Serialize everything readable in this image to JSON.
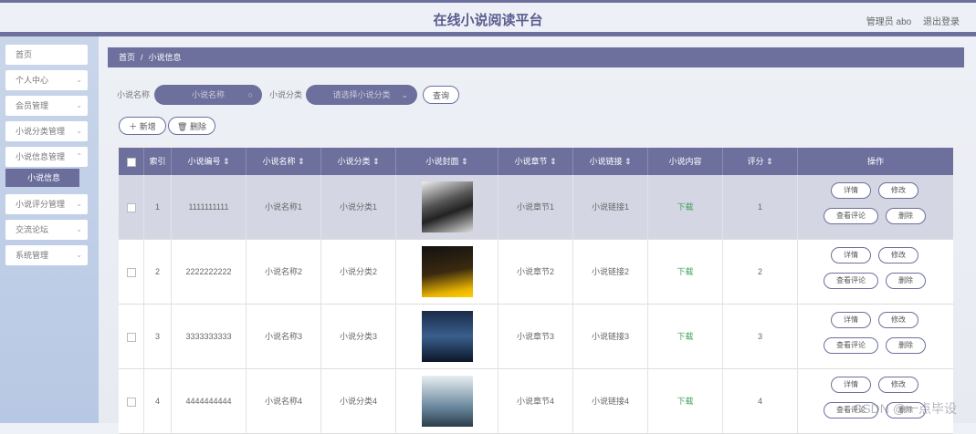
{
  "header": {
    "title": "在线小说阅读平台",
    "user_label": "管理员 abo",
    "logout": "退出登录"
  },
  "sidebar": {
    "items": [
      {
        "label": "首页",
        "chevron": false
      },
      {
        "label": "个人中心",
        "chevron": true
      },
      {
        "label": "会员管理",
        "chevron": true
      },
      {
        "label": "小说分类管理",
        "chevron": true
      },
      {
        "label": "小说信息管理",
        "chevron": true
      },
      {
        "label": "小说评分管理",
        "chevron": true
      },
      {
        "label": "交流论坛",
        "chevron": true
      },
      {
        "label": "系统管理",
        "chevron": true
      }
    ],
    "active_sub": "小说信息"
  },
  "breadcrumb": {
    "home": "首页",
    "sep": "/",
    "current": "小说信息"
  },
  "search": {
    "name_label": "小说名称",
    "name_placeholder": "小说名称",
    "category_label": "小说分类",
    "category_placeholder": "请选择小说分类",
    "query_button": "查询"
  },
  "actions": {
    "add": "＋ 新增",
    "delete": "🗑 删除"
  },
  "table": {
    "headers": [
      "索引",
      "小说编号 ⇕",
      "小说名称 ⇕",
      "小说分类 ⇕",
      "小说封面 ⇕",
      "小说章节 ⇕",
      "小说链接 ⇕",
      "小说内容",
      "评分 ⇕",
      "操作"
    ],
    "rows": [
      {
        "index": "1",
        "code": "1111111111",
        "name": "小说名称1",
        "category": "小说分类1",
        "chapter": "小说章节1",
        "link": "小说链接1",
        "content": "下载",
        "score": "1"
      },
      {
        "index": "2",
        "code": "2222222222",
        "name": "小说名称2",
        "category": "小说分类2",
        "chapter": "小说章节2",
        "link": "小说链接2",
        "content": "下载",
        "score": "2"
      },
      {
        "index": "3",
        "code": "3333333333",
        "name": "小说名称3",
        "category": "小说分类3",
        "chapter": "小说章节3",
        "link": "小说链接3",
        "content": "下载",
        "score": "3"
      },
      {
        "index": "4",
        "code": "4444444444",
        "name": "小说名称4",
        "category": "小说分类4",
        "chapter": "小说章节4",
        "link": "小说链接4",
        "content": "下载",
        "score": "4"
      }
    ],
    "ops": {
      "detail": "详情",
      "edit": "修改",
      "review": "查看评论",
      "remove": "删除"
    }
  },
  "watermark": "CSDN @一点毕设",
  "colors": {
    "accent": "#6d6f9c",
    "green": "#3aa35a"
  }
}
